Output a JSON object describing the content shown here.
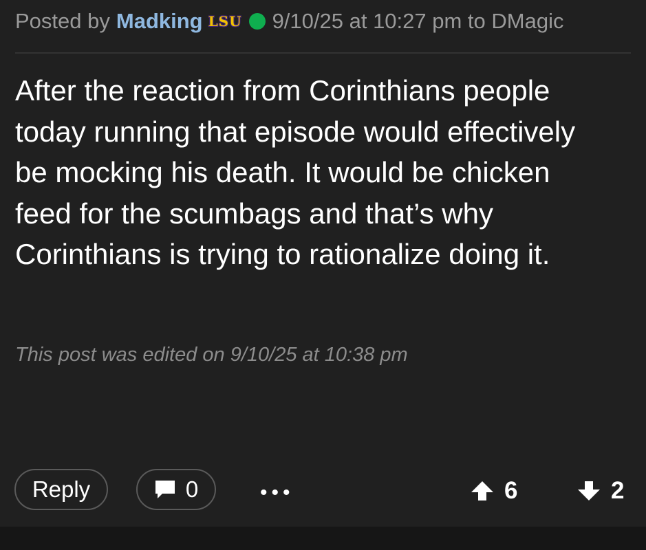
{
  "header": {
    "posted_by_label": "Posted by",
    "author": "Madking",
    "team_logo_text": "LSU",
    "timestamp_text": "9/10/25 at 10:27 pm to DMagic",
    "online_status_color": "#0fae4f"
  },
  "post": {
    "body_lines": [
      "After the reaction from Corinthians people",
      "today running that episode would effectively",
      "be mocking his death. It would be chicken",
      "feed for the scumbags and that’s why",
      "Corinthians is trying to rationalize doing it."
    ],
    "edit_note": "This post was edited on 9/10/25 at 10:38 pm"
  },
  "actions": {
    "reply_label": "Reply",
    "comment_count": "0",
    "more_label": "•••",
    "upvote_count": "6",
    "downvote_count": "2"
  },
  "icons": {
    "comment": "comment-icon",
    "upvote": "arrow-up-icon",
    "downvote": "arrow-down-icon",
    "online": "online-status-icon"
  }
}
